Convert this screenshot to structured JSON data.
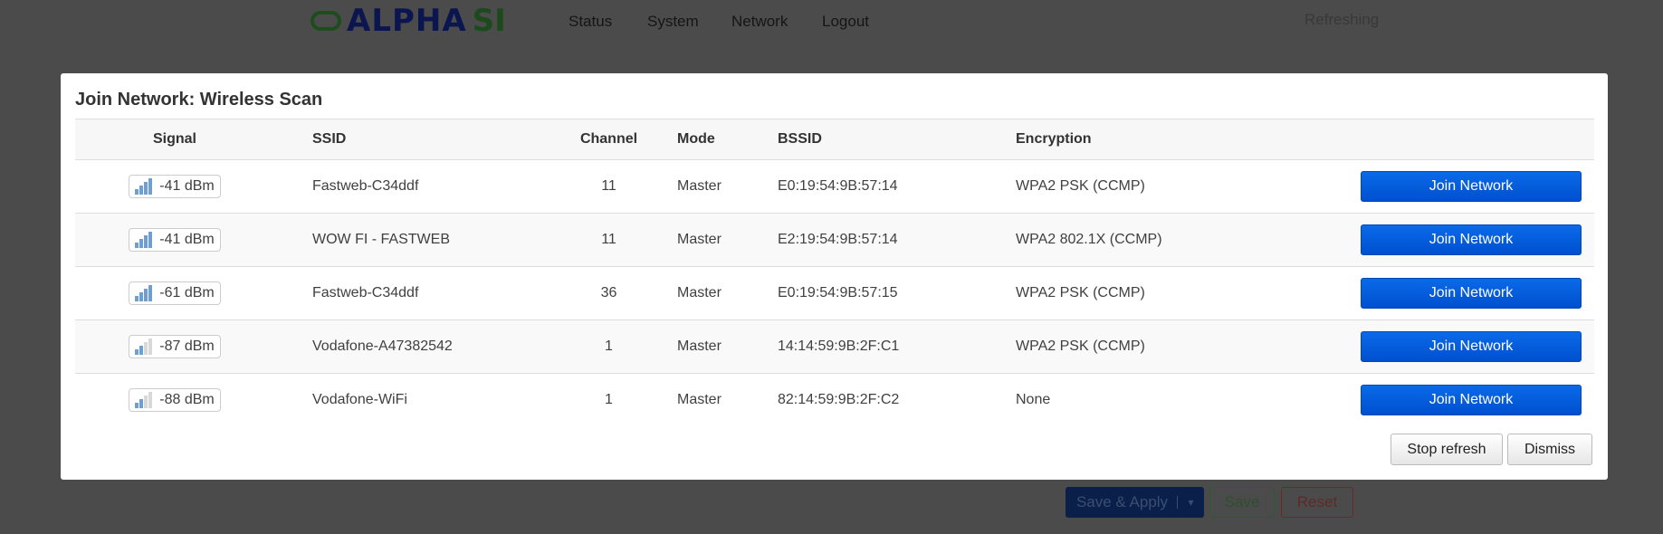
{
  "header": {
    "logo_text": "alpha SI",
    "nav": [
      "Status",
      "System",
      "Network",
      "Logout"
    ],
    "status": "Refreshing"
  },
  "page_buttons": {
    "save_apply": "Save & Apply",
    "dropdown": "▾",
    "save": "Save",
    "reset": "Reset"
  },
  "modal": {
    "title": "Join Network: Wireless Scan",
    "columns": [
      "Signal",
      "SSID",
      "Channel",
      "Mode",
      "BSSID",
      "Encryption"
    ],
    "rows": [
      {
        "signal": "-41 dBm",
        "bars": 4,
        "ssid": "Fastweb-C34ddf",
        "channel": "11",
        "mode": "Master",
        "bssid": "E0:19:54:9B:57:14",
        "encryption": "WPA2 PSK (CCMP)",
        "action": "Join Network"
      },
      {
        "signal": "-41 dBm",
        "bars": 4,
        "ssid": "WOW FI - FASTWEB",
        "channel": "11",
        "mode": "Master",
        "bssid": "E2:19:54:9B:57:14",
        "encryption": "WPA2 802.1X (CCMP)",
        "action": "Join Network"
      },
      {
        "signal": "-61 dBm",
        "bars": 4,
        "ssid": "Fastweb-C34ddf",
        "channel": "36",
        "mode": "Master",
        "bssid": "E0:19:54:9B:57:15",
        "encryption": "WPA2 PSK (CCMP)",
        "action": "Join Network"
      },
      {
        "signal": "-87 dBm",
        "bars": 2,
        "ssid": "Vodafone-A47382542",
        "channel": "1",
        "mode": "Master",
        "bssid": "14:14:59:9B:2F:C1",
        "encryption": "WPA2 PSK (CCMP)",
        "action": "Join Network"
      },
      {
        "signal": "-88 dBm",
        "bars": 2,
        "ssid": "Vodafone-WiFi",
        "channel": "1",
        "mode": "Master",
        "bssid": "82:14:59:9B:2F:C2",
        "encryption": "None",
        "action": "Join Network"
      }
    ],
    "stop_refresh": "Stop refresh",
    "dismiss": "Dismiss"
  },
  "colors": {
    "overlay": "#4b4b4b",
    "join_button": "#0a5fe0"
  }
}
